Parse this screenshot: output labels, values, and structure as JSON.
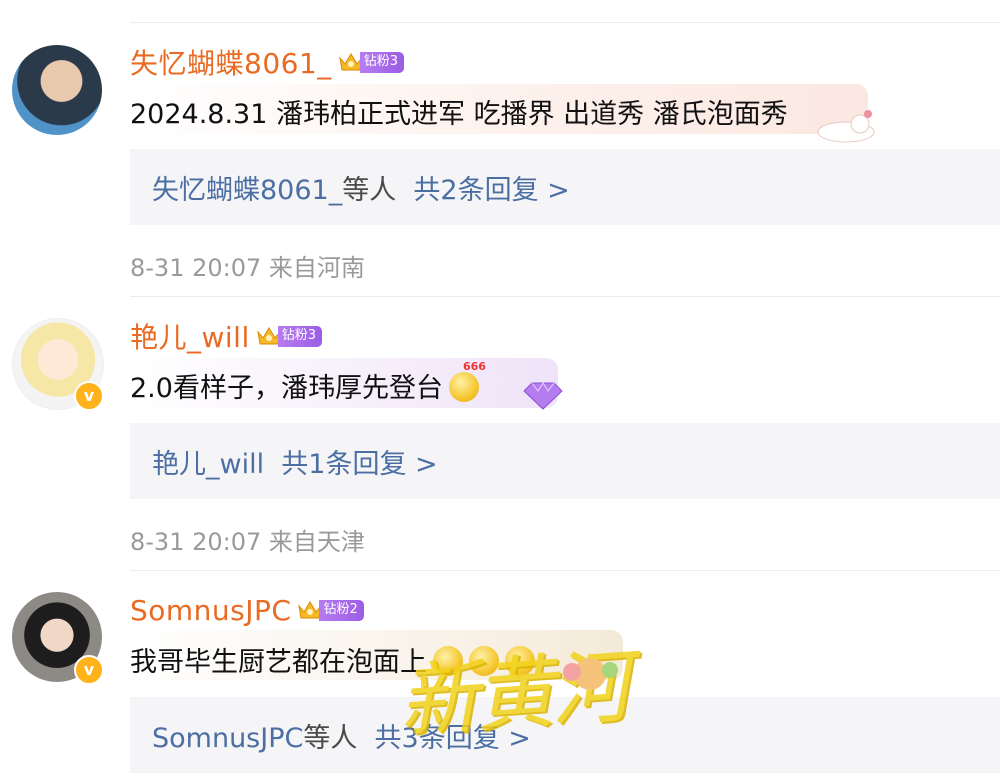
{
  "comments": [
    {
      "username": "失忆蝴蝶8061_",
      "badge": "钻粉3",
      "text": "2024.8.31 潘玮柏正式进军 吃播界 出道秀  潘氏泡面秀",
      "reply_user": "失忆蝴蝶8061_",
      "reply_suffix": "等人",
      "reply_count": "共2条回复 >",
      "time": "8-31 20:07",
      "location": "来自河南"
    },
    {
      "username": "艳儿_will",
      "badge": "钻粉3",
      "text": "2.0看样子，潘玮厚先登台",
      "emoji_label": "666",
      "reply_user": "艳儿_will",
      "reply_count": "共1条回复 >",
      "time": "8-31 20:07",
      "location": "来自天津"
    },
    {
      "username": "SomnusJPC",
      "badge": "钻粉2",
      "text": "我哥毕生厨艺都在泡面上",
      "reply_user": "SomnusJPC",
      "reply_suffix": "等人",
      "reply_count": "共3条回复 >"
    }
  ],
  "watermark": "新黄河",
  "colors": {
    "username": "#ea6a22",
    "link": "#4c6fa3",
    "meta": "#9a9a9a",
    "reply_bg": "#f5f5f7",
    "badge": "#9b5de5"
  }
}
